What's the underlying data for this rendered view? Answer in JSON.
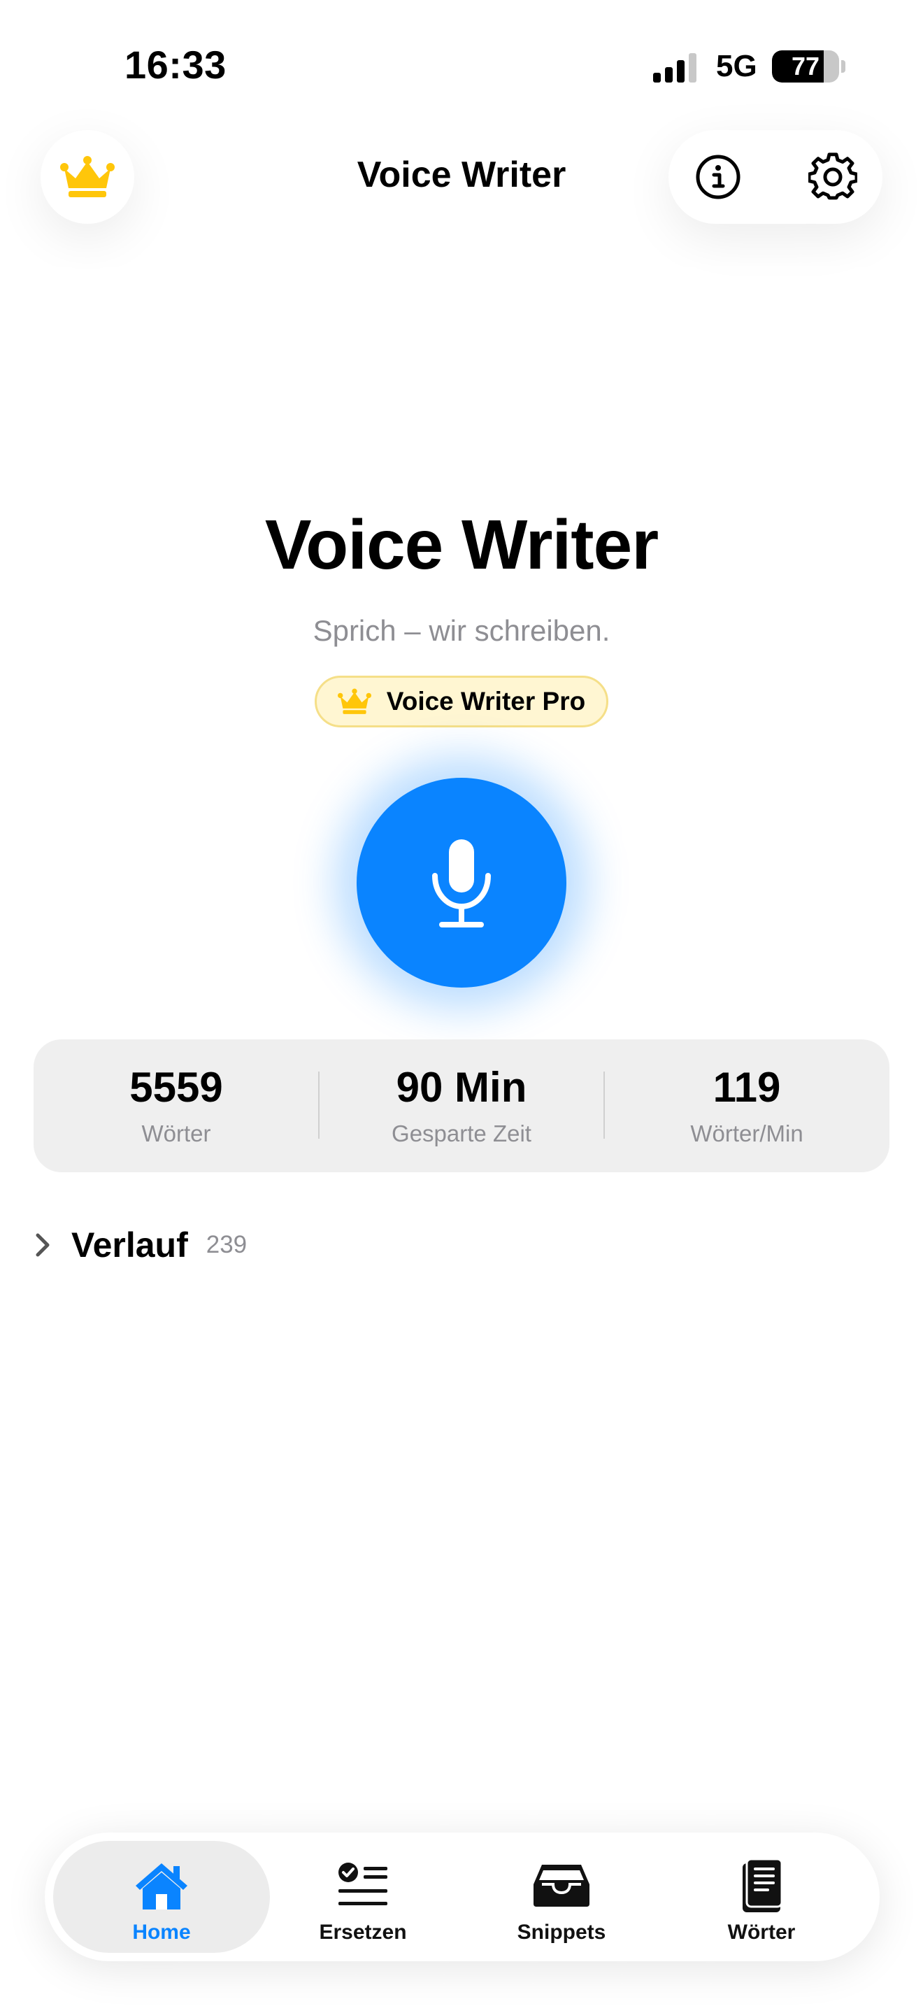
{
  "status_bar": {
    "time": "16:33",
    "network": "5G",
    "battery": "77",
    "battery_level": 0.77
  },
  "header": {
    "title": "Voice Writer",
    "left_icon": "crown-icon",
    "right_icons": [
      "info-icon",
      "gear-icon"
    ]
  },
  "hero": {
    "title": "Voice Writer",
    "subtitle": "Sprich – wir schreiben.",
    "badge_label": "Voice Writer Pro",
    "badge_icon": "crown-icon",
    "mic_icon": "microphone-icon"
  },
  "stats": [
    {
      "value": "5559",
      "label": "Wörter"
    },
    {
      "value": "90 Min",
      "label": "Gesparte Zeit"
    },
    {
      "value": "119",
      "label": "Wörter/Min"
    }
  ],
  "history": {
    "title": "Verlauf",
    "count": "239"
  },
  "tabs": [
    {
      "label": "Home",
      "icon": "home-icon",
      "active": true
    },
    {
      "label": "Ersetzen",
      "icon": "checklist-icon",
      "active": false
    },
    {
      "label": "Snippets",
      "icon": "tray-icon",
      "active": false
    },
    {
      "label": "Wörter",
      "icon": "book-icon",
      "active": false
    }
  ],
  "colors": {
    "accent": "#0a84ff",
    "crown": "#ffc60a",
    "badge_bg": "#fff6d2",
    "secondary_text": "#8e8e93",
    "card_bg": "#efefef"
  }
}
